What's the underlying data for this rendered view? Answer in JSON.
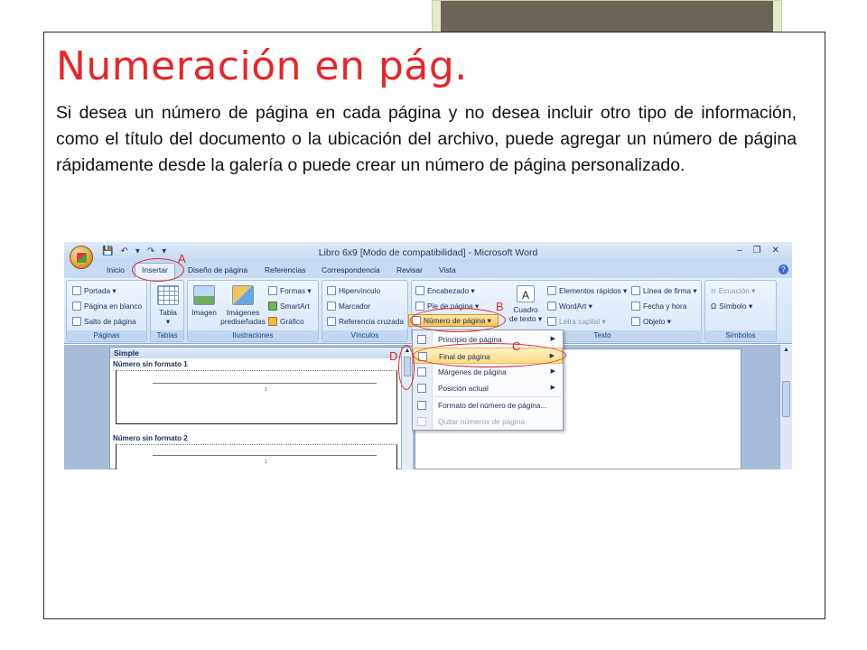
{
  "slide": {
    "title": "Numeración en pág.",
    "body": "Si desea un número de página en cada página y no desea incluir otro tipo de información, como el título del documento o la ubicación del archivo, puede agregar un número de página rápidamente desde la galería o puede crear un número de página personalizado.",
    "title_color": "#e8262a"
  },
  "word": {
    "window_title": "Libro 6x9 [Modo de compatibilidad] - Microsoft Word",
    "qat": [
      "💾",
      "↶",
      "▾",
      "↷",
      "▾"
    ],
    "win_controls": [
      "–",
      "❐",
      "✕"
    ],
    "tabs": [
      "Inicio",
      "Insertar",
      "Diseño de página",
      "Referencias",
      "Correspondencia",
      "Revisar",
      "Vista"
    ],
    "active_tab": "Insertar",
    "groups": {
      "paginas": {
        "label": "Páginas",
        "items": [
          "Portada ▾",
          "Página en blanco",
          "Salto de página"
        ]
      },
      "tablas": {
        "label": "Tablas",
        "item": "Tabla",
        "arrow": "▾"
      },
      "ilustraciones": {
        "label": "Ilustraciones",
        "imagen": "Imagen",
        "imagenes_line1": "Imágenes",
        "imagenes_line2": "prediseñadas",
        "formas": "Formas ▾",
        "smartart": "SmartArt",
        "grafico": "Gráfico"
      },
      "vinculos": {
        "label": "Vínculos",
        "items": [
          "Hipervínculo",
          "Marcador",
          "Referencia cruzada"
        ]
      },
      "encabezado": {
        "items": [
          "Encabezado ▾",
          "Pie de página ▾",
          "Número de página ▾"
        ]
      },
      "texto": {
        "label": "Texto",
        "cuadro_line1": "Cuadro",
        "cuadro_line2": "de texto ▾",
        "cuadro_glyph": "A",
        "items": [
          "Elementos rápidos ▾",
          "WordArt ▾",
          "Letra capital ▾"
        ],
        "items2": [
          "Línea de firma ▾",
          "Fecha y hora",
          "Objeto ▾"
        ]
      },
      "simbolos": {
        "label": "Símbolos",
        "items": [
          "Ecuación ▾",
          "Símbolo ▾"
        ],
        "icons": [
          "π",
          "Ω"
        ]
      }
    },
    "help": "?",
    "gallery": {
      "header": "Simple",
      "option1": "Número sin formato 1",
      "option2": "Número sin formato 2",
      "page_num": "1"
    },
    "menu": [
      {
        "label": "Principio de página",
        "submenu": true
      },
      {
        "label": "Final de página",
        "submenu": true
      },
      {
        "label": "Márgenes de página",
        "submenu": true
      },
      {
        "label": "Posición actual",
        "submenu": true
      },
      {
        "label": "Formato del número de página...",
        "submenu": false
      },
      {
        "label": "Quitar números de página",
        "submenu": false
      }
    ],
    "submenu_arrow": "▶",
    "scroll_arrows": [
      "▲",
      "▼"
    ],
    "annotations": [
      "A",
      "B",
      "C",
      "D"
    ],
    "annotation_color": "#e0262c"
  }
}
